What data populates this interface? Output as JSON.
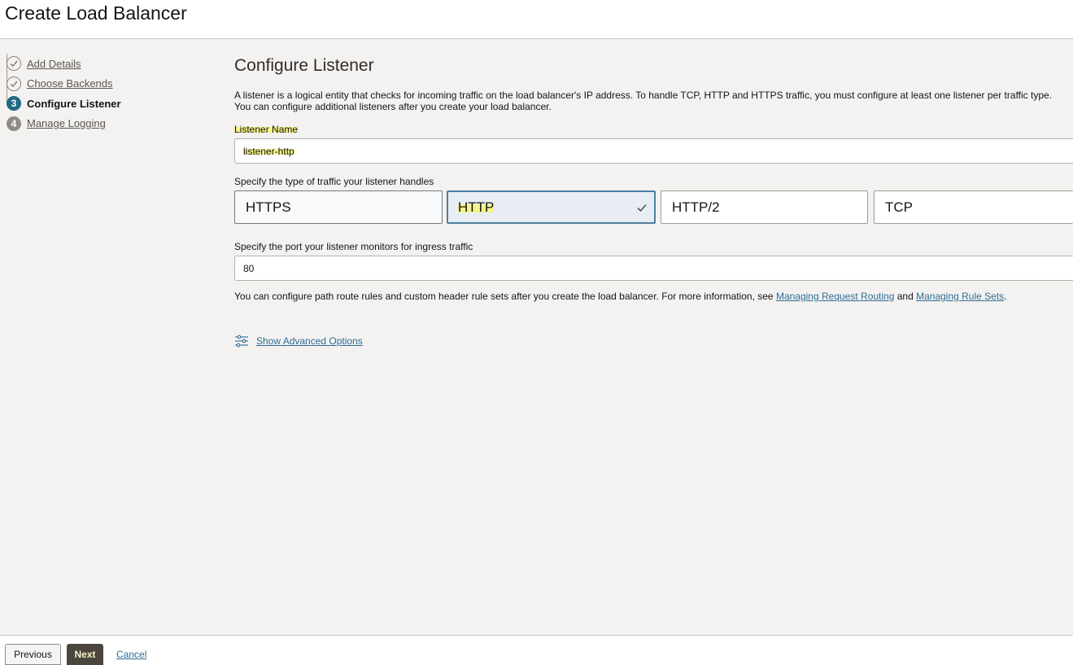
{
  "header": {
    "title": "Create Load Balancer"
  },
  "steps": [
    {
      "number": "1",
      "label": "Add Details",
      "state": "completed"
    },
    {
      "number": "2",
      "label": "Choose Backends",
      "state": "completed"
    },
    {
      "number": "3",
      "label": "Configure Listener",
      "state": "current"
    },
    {
      "number": "4",
      "label": "Manage Logging",
      "state": "upcoming"
    }
  ],
  "section": {
    "title": "Configure Listener",
    "description": "A listener is a logical entity that checks for incoming traffic on the load balancer's IP address. To handle TCP, HTTP and HTTPS traffic, you must configure at least one listener per traffic type. You can configure additional listeners after you create your load balancer."
  },
  "listener_name": {
    "label": "Listener Name",
    "value": "listener-http"
  },
  "traffic_type": {
    "label": "Specify the type of traffic your listener handles",
    "options": [
      "HTTPS",
      "HTTP",
      "HTTP/2",
      "TCP"
    ],
    "selected": "HTTP"
  },
  "port": {
    "label": "Specify the port your listener monitors for ingress traffic",
    "value": "80"
  },
  "info": {
    "text_before": "You can configure path route rules and custom header rule sets after you create the load balancer. For more information, see ",
    "link1": "Managing Request Routing",
    "text_middle": " and ",
    "link2": "Managing Rule Sets",
    "text_after": "."
  },
  "advanced": {
    "label": "Show Advanced Options",
    "icon": "sliders-icon"
  },
  "footer": {
    "previous": "Previous",
    "next": "Next",
    "cancel": "Cancel"
  },
  "colors": {
    "accent": "#1e6a86",
    "link": "#2c6d95",
    "highlight": "#f5f38a",
    "selected_tile_border": "#4d7fa0"
  }
}
